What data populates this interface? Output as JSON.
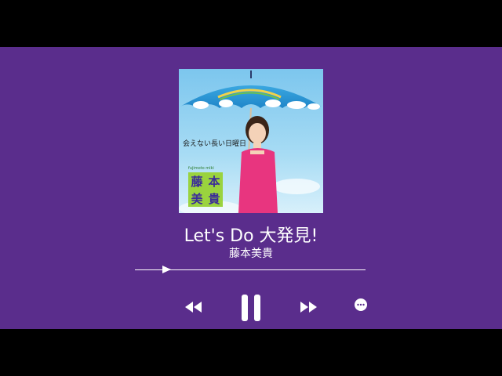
{
  "album": {
    "cover_label": "会えない長い日曜日",
    "cover_small": "fujimoto miki",
    "cover_name_chars": [
      "藤",
      "本",
      "美",
      "貴"
    ]
  },
  "track": {
    "title": "Let's Do 大発見!",
    "artist": "藤本美貴"
  },
  "playback": {
    "progress": 0.12,
    "state": "playing"
  },
  "controls": {
    "prev_icon": "rewind-icon",
    "pause_icon": "pause-icon",
    "next_icon": "fast-forward-icon",
    "more_icon": "more-icon"
  },
  "colors": {
    "background": "#5a2d8c",
    "letterbox": "#000000",
    "foreground": "#ffffff"
  }
}
